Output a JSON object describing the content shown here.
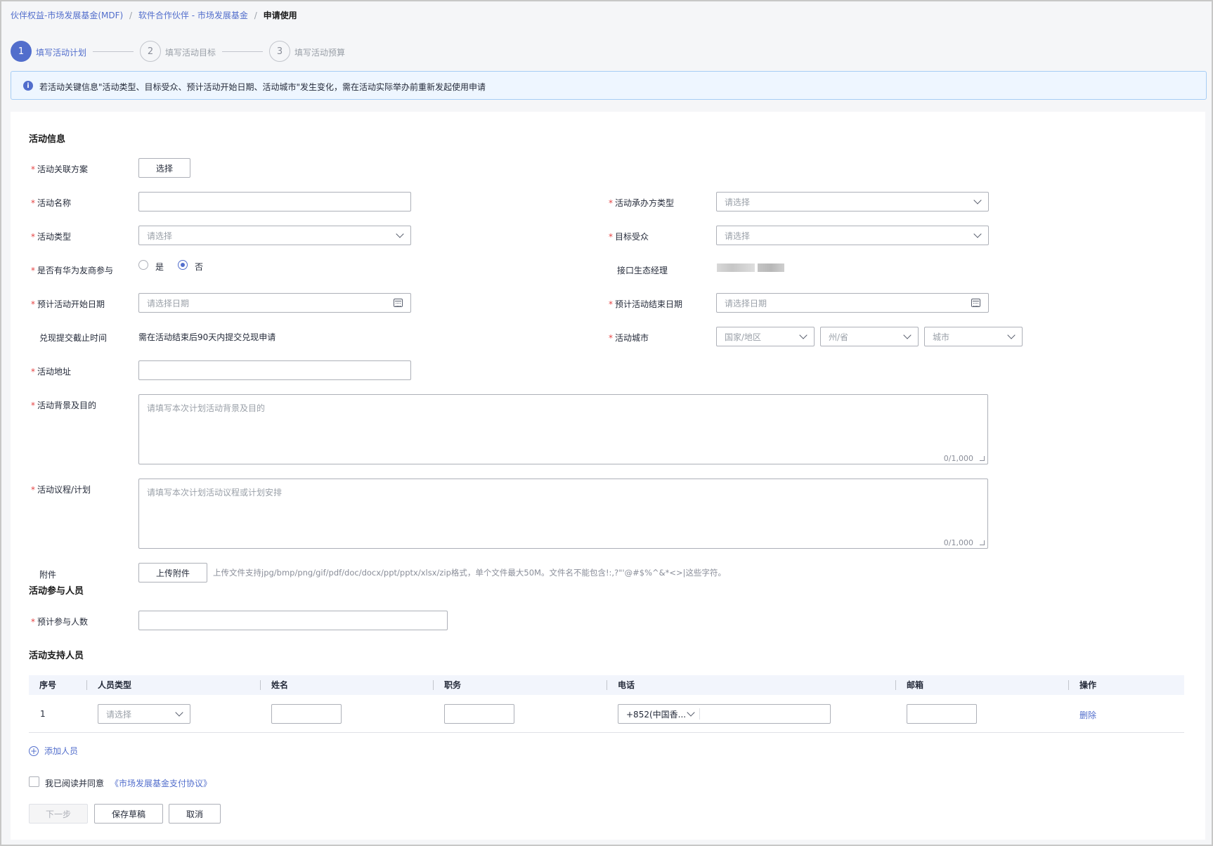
{
  "breadcrumb": {
    "items": [
      "伙伴权益-市场发展基金(MDF)",
      "软件合作伙伴 - 市场发展基金"
    ],
    "current": "申请使用",
    "separator": "/"
  },
  "steps": [
    {
      "num": "1",
      "label": "填写活动计划",
      "active": true
    },
    {
      "num": "2",
      "label": "填写活动目标",
      "active": false
    },
    {
      "num": "3",
      "label": "填写活动预算",
      "active": false
    }
  ],
  "notice": {
    "icon": "info-icon",
    "text": "若活动关键信息\"活动类型、目标受众、预计活动开始日期、活动城市\"发生变化，需在活动实际举办前重新发起使用申请"
  },
  "activity_info": {
    "title": "活动信息",
    "linked_plan_label": "活动关联方案",
    "select_button": "选择",
    "name_label": "活动名称",
    "name_value": "",
    "organizer_type_label": "活动承办方类型",
    "organizer_type_placeholder": "请选择",
    "type_label": "活动类型",
    "type_placeholder": "请选择",
    "audience_label": "目标受众",
    "audience_placeholder": "请选择",
    "huawei_partner_label": "是否有华为友商参与",
    "radio_yes": "是",
    "radio_no": "否",
    "radio_selected": "否",
    "eco_manager_label": "接口生态经理",
    "start_date_label": "预计活动开始日期",
    "start_date_placeholder": "请选择日期",
    "end_date_label": "预计活动结束日期",
    "end_date_placeholder": "请选择日期",
    "deadline_label": "兑现提交截止时间",
    "deadline_value": "需在活动结束后90天内提交兑现申请",
    "city_label": "活动城市",
    "country_placeholder": "国家/地区",
    "state_placeholder": "州/省",
    "city_placeholder": "城市",
    "address_label": "活动地址",
    "address_value": "",
    "background_label": "活动背景及目的",
    "background_placeholder": "请填写本次计划活动背景及目的",
    "background_count": "0/1,000",
    "agenda_label": "活动议程/计划",
    "agenda_placeholder": "请填写本次计划活动议程或计划安排",
    "agenda_count": "0/1,000",
    "attachment_label": "附件",
    "upload_button": "上传附件",
    "upload_hint": "上传文件支持jpg/bmp/png/gif/pdf/doc/docx/ppt/pptx/xlsx/zip格式，单个文件最大50M。文件名不能包含!:,?\"'@#$%^&*<>|这些字符。"
  },
  "participants": {
    "title": "活动参与人员",
    "count_label": "预计参与人数",
    "count_value": ""
  },
  "support_staff": {
    "title": "活动支持人员",
    "columns": [
      "序号",
      "人员类型",
      "姓名",
      "职务",
      "电话",
      "邮箱",
      "操作"
    ],
    "rows": [
      {
        "index": "1",
        "type_placeholder": "请选择",
        "name": "",
        "position": "",
        "phone_code": "+852(中国香...",
        "phone": "",
        "email": "",
        "action": "删除"
      }
    ],
    "add_label": "添加人员"
  },
  "agreement": {
    "prefix": "我已阅读并同意",
    "link": "《市场发展基金支付协议》",
    "checked": false
  },
  "footer": {
    "next": "下一步",
    "save_draft": "保存草稿",
    "cancel": "取消"
  },
  "colors": {
    "accent": "#526ecc",
    "required": "#e54545",
    "notice_bg": "#eef6ff",
    "notice_border": "#a6cdf5"
  }
}
